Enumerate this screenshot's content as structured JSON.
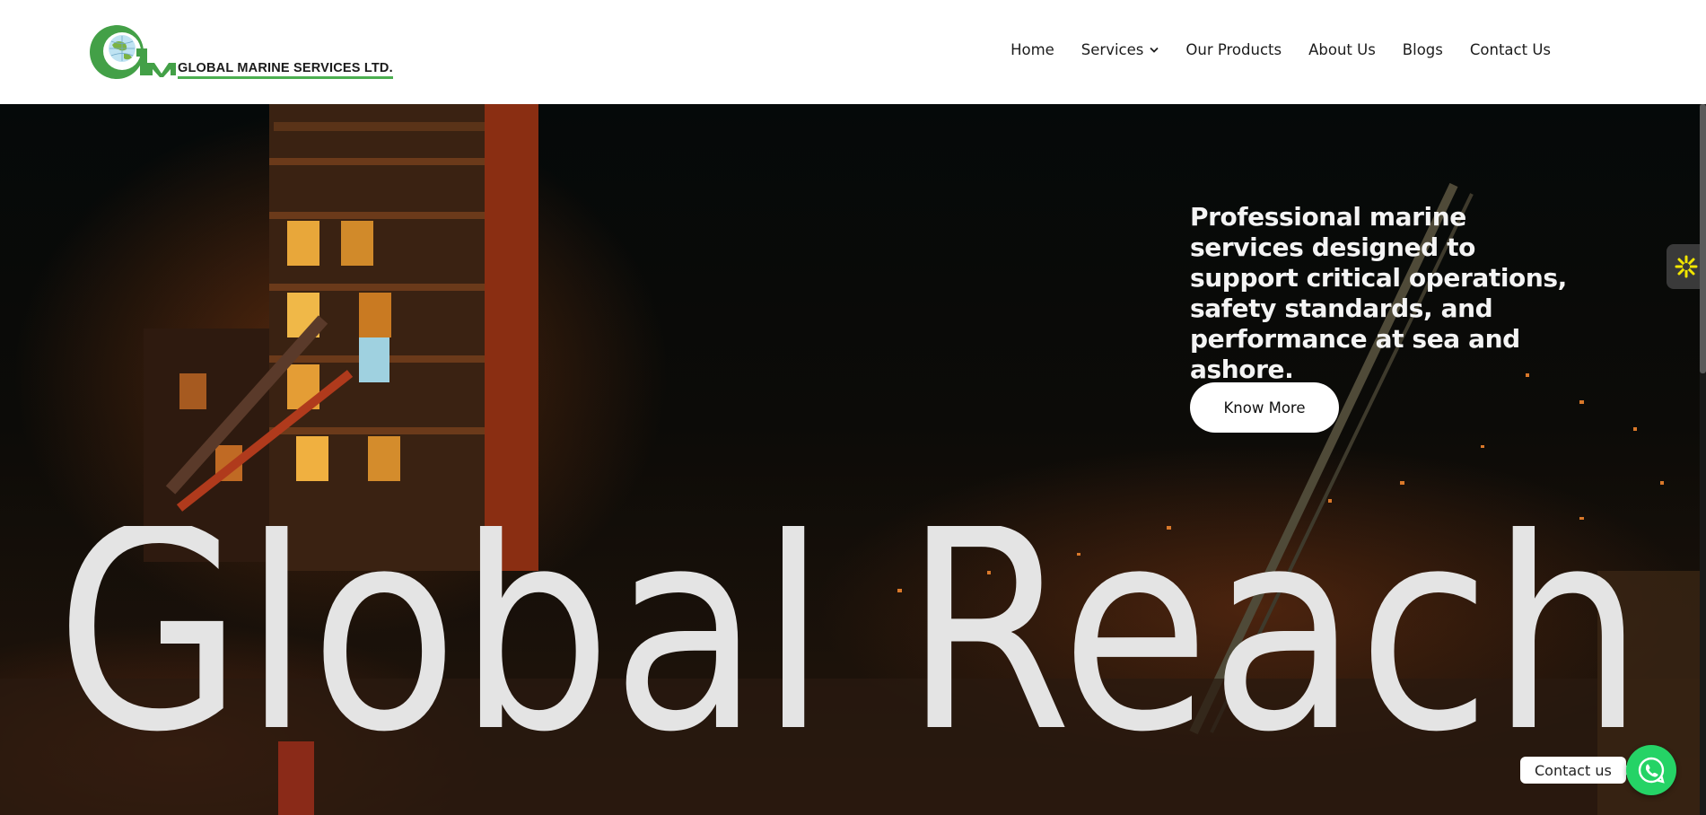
{
  "header": {
    "logo_initials": "GM",
    "logo_text": "GLOBAL MARINE SERVICES LTD."
  },
  "nav": {
    "items": [
      {
        "label": "Home"
      },
      {
        "label": "Services"
      },
      {
        "label": "Our Products"
      },
      {
        "label": "About Us"
      },
      {
        "label": "Blogs"
      },
      {
        "label": "Contact Us"
      }
    ]
  },
  "hero": {
    "headline": "Professional marine services designed to support critical operations, safety standards, and performance at sea and ashore.",
    "cta_label": "Know More",
    "big_title": "Global Reach"
  },
  "widgets": {
    "contact_label": "Contact us",
    "accessibility_icon": "accessibility-icon",
    "whatsapp_icon": "whatsapp-icon"
  },
  "colors": {
    "brand_green": "#4caf50",
    "whatsapp_green": "#25d366",
    "hero_text": "#f4f4f4",
    "big_title": "#e4e4e4"
  }
}
